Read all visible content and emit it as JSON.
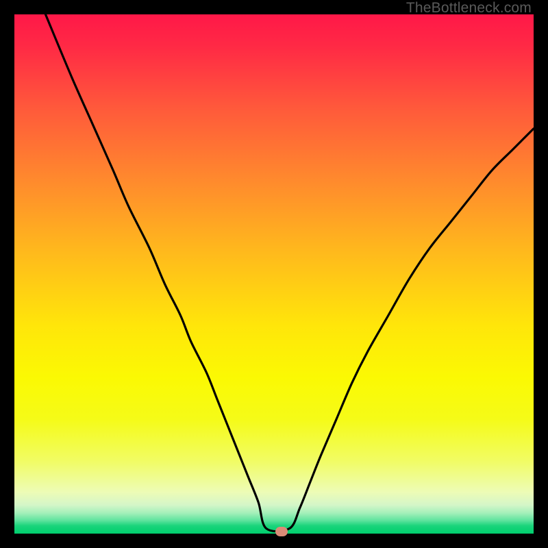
{
  "attribution": "TheBottleneck.com",
  "marker": {
    "x_pct": 51.5,
    "y_bottom_pct": 0
  },
  "chart_data": {
    "type": "line",
    "title": "",
    "xlabel": "",
    "ylabel": "",
    "xlim": [
      0,
      100
    ],
    "ylim": [
      0,
      100
    ],
    "series": [
      {
        "name": "bottleneck-curve",
        "x": [
          6,
          11,
          15,
          19,
          22,
          26,
          29,
          32,
          34,
          37,
          39,
          41,
          43,
          45,
          47,
          48.5,
          53,
          55,
          57,
          59,
          62,
          65,
          68,
          72,
          76,
          80,
          84,
          88,
          92,
          96,
          100
        ],
        "values": [
          100,
          88,
          79,
          70,
          63,
          55,
          48,
          42,
          37,
          31,
          26,
          21,
          16,
          11,
          6,
          1,
          1,
          5,
          10,
          15,
          22,
          29,
          35,
          42,
          49,
          55,
          60,
          65,
          70,
          74,
          78
        ]
      }
    ],
    "annotations": [
      {
        "type": "marker",
        "x": 51.5,
        "y": 0,
        "color": "#db8b77"
      }
    ],
    "background_gradient": {
      "top_color": "#ff1848",
      "mid_color": "#ffe60a",
      "bottom_color": "#00cf6e"
    }
  }
}
